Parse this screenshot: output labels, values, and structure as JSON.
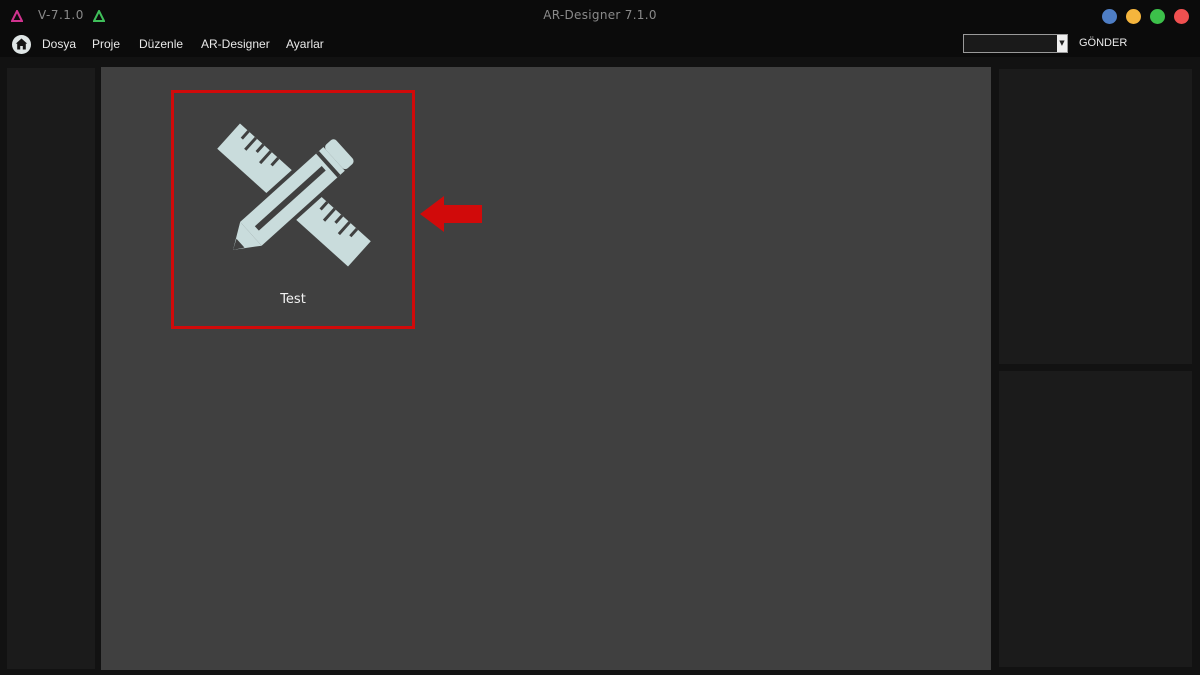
{
  "titlebar": {
    "version": "V-7.1.0",
    "title": "AR-Designer 7.1.0",
    "logo_icon": "ar-designer-logo-icon",
    "window_buttons": [
      {
        "name": "blue-window-button",
        "color": "#4e7ec5"
      },
      {
        "name": "minimize-button",
        "color": "#f5b53d"
      },
      {
        "name": "maximize-button",
        "color": "#3cc04a"
      },
      {
        "name": "close-button",
        "color": "#f05050"
      }
    ]
  },
  "menubar": {
    "home_icon": "home-icon",
    "items": [
      "Dosya",
      "Proje",
      "Düzenle",
      "AR-Designer",
      "Ayarlar"
    ],
    "send_select_value": "",
    "send_label": "GÖNDER"
  },
  "canvas": {
    "project": {
      "label": "Test",
      "icon": "pencil-ruler-icon",
      "highlight_color": "#d10a0a",
      "pointer_icon": "red-arrow-left-icon"
    }
  },
  "colors": {
    "canvas_bg": "#404040",
    "panel_bg": "#1b1b1b",
    "icon_color": "#c9dcdc"
  }
}
